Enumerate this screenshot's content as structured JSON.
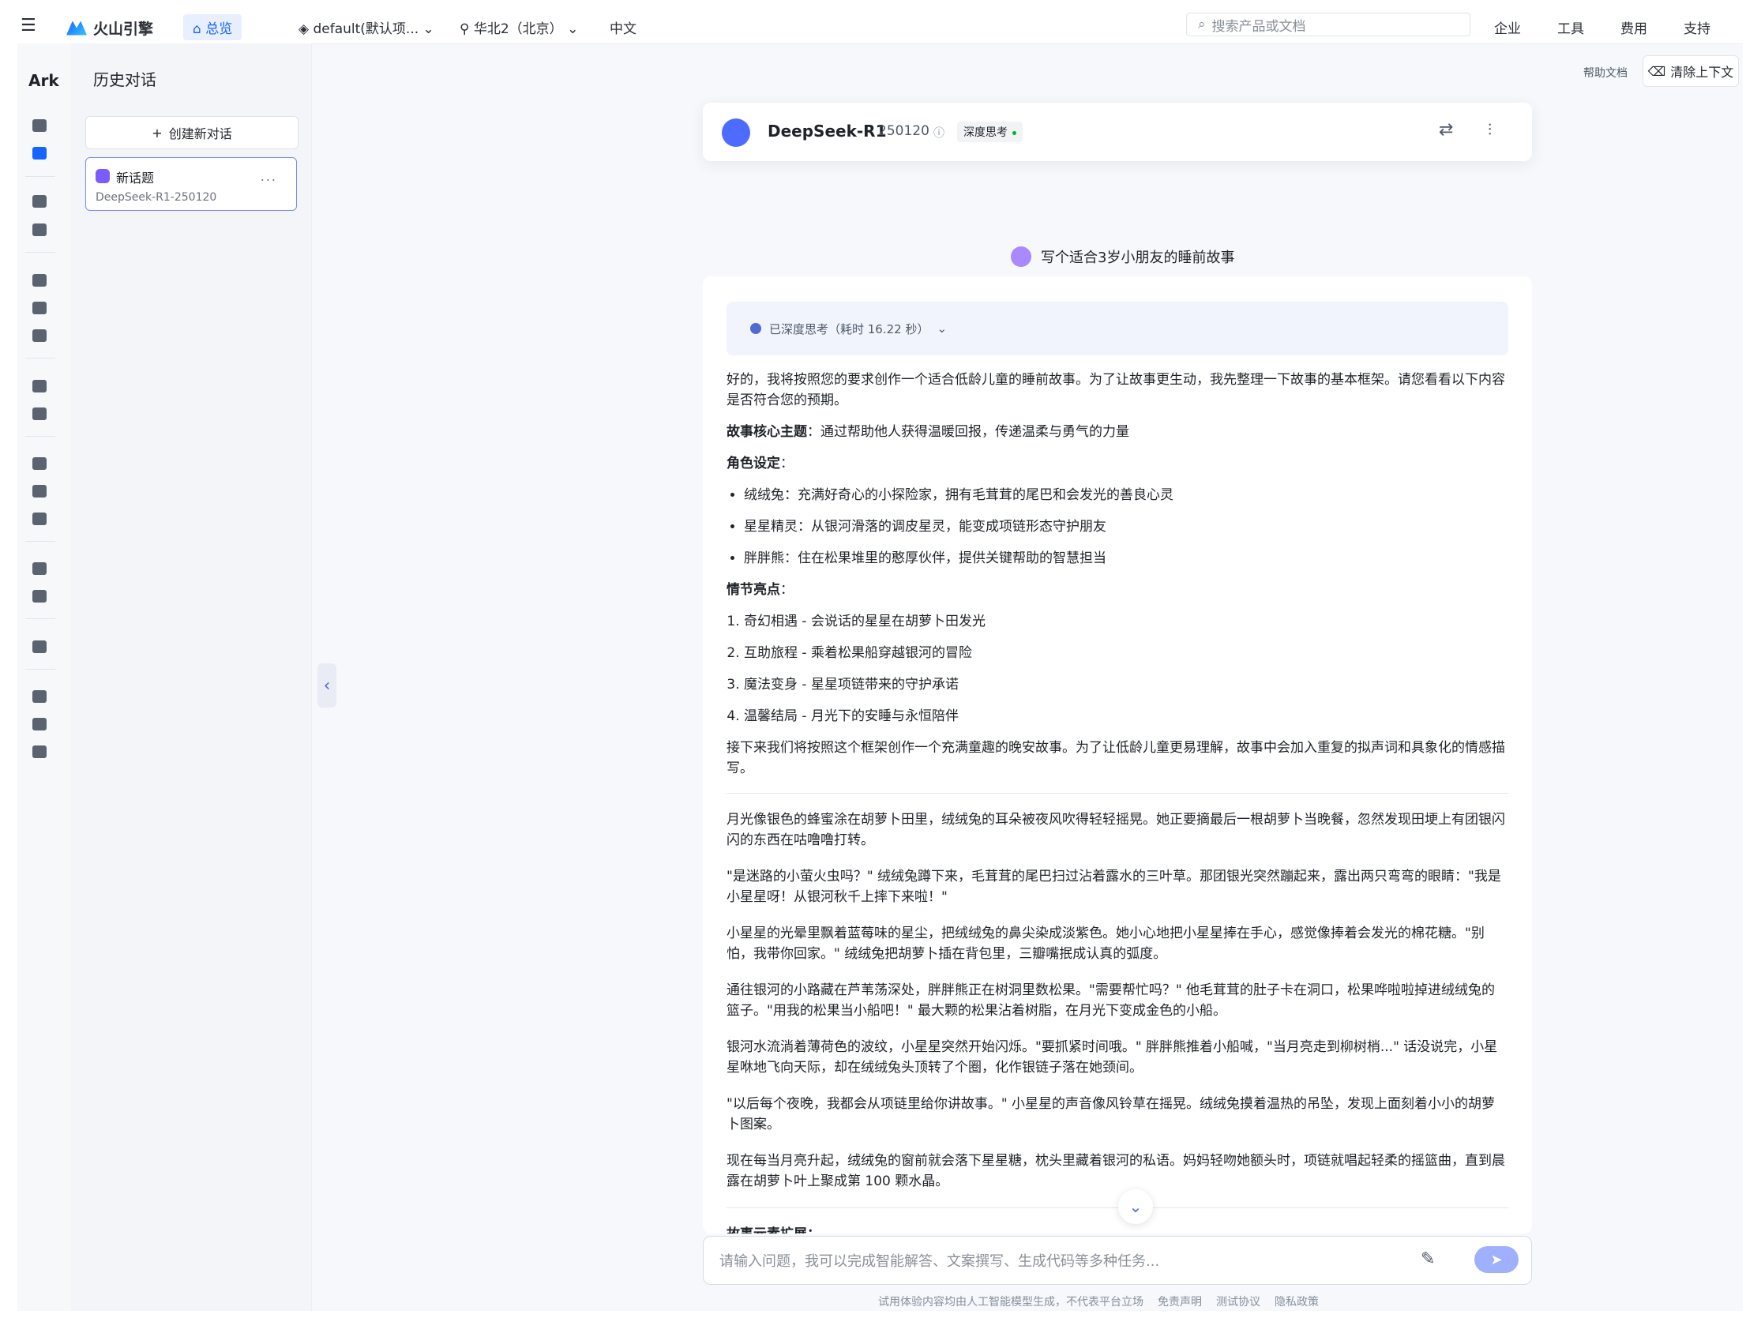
{
  "topbar": {
    "menu_icon": "menu-icon",
    "brand": "火山引擎",
    "home_label": "总览",
    "project_label": "default(默认项...",
    "region_label": "华北2（北京）",
    "language_label": "中文",
    "search_placeholder": "搜索产品或文档",
    "right_menus": [
      "企业",
      "工具",
      "费用",
      "支持"
    ]
  },
  "rail": {
    "brand": "Ark",
    "icons": [
      "bulb-icon",
      "chat-icon",
      "apps-icon",
      "storage-icon",
      "terminal-icon",
      "image-icon",
      "message-icon",
      "chart-icon",
      "rocket-icon",
      "tune-icon",
      "cube-icon",
      "flask-icon",
      "dashboard-icon",
      "server-icon",
      "headset-icon",
      "doc-icon",
      "shield-icon",
      "globe-icon"
    ]
  },
  "history": {
    "title": "历史对话",
    "new_chat_label": "创建新对话",
    "items": [
      {
        "title": "新话题",
        "subtitle": "DeepSeek-R1-250120",
        "more": "..."
      }
    ]
  },
  "header_actions": {
    "help_label": "帮助文档",
    "clear_label": "清除上下文"
  },
  "model": {
    "name": "DeepSeek-R1",
    "version": "250120",
    "badge": "深度思考"
  },
  "conversation": {
    "user_message": "写个适合3岁小朋友的睡前故事",
    "think_label": "已深度思考（耗时 16.22 秒）",
    "intro": "好的，我将按照您的要求创作一个适合低龄儿童的睡前故事。为了让故事更生动，我先整理一下故事的基本框架。请您看看以下内容是否符合您的预期。",
    "theme_label": "故事核心主题",
    "theme_text": "：通过帮助他人获得温暖回报，传递温柔与勇气的力量",
    "roles_label": "角色设定",
    "roles_colon": "：",
    "roles": [
      "绒绒兔：充满好奇心的小探险家，拥有毛茸茸的尾巴和会发光的善良心灵",
      "星星精灵：从银河滑落的调皮星灵，能变成项链形态守护朋友",
      "胖胖熊：住在松果堆里的憨厚伙伴，提供关键帮助的智慧担当"
    ],
    "plot_label": "情节亮点",
    "plot_colon": "：",
    "plot": [
      "奇幻相遇 - 会说话的星星在胡萝卜田发光",
      "互助旅程 - 乘着松果船穿越银河的冒险",
      "魔法变身 - 星星项链带来的守护承诺",
      "温馨结局 - 月光下的安睡与永恒陪伴"
    ],
    "transition": "接下来我们将按照这个框架创作一个充满童趣的晚安故事。为了让低龄儿童更易理解，故事中会加入重复的拟声词和具象化的情感描写。",
    "story": [
      "月光像银色的蜂蜜涂在胡萝卜田里，绒绒兔的耳朵被夜风吹得轻轻摇晃。她正要摘最后一根胡萝卜当晚餐，忽然发现田埂上有团银闪闪的东西在咕噜噜打转。",
      "\"是迷路的小萤火虫吗？\" 绒绒兔蹲下来，毛茸茸的尾巴扫过沾着露水的三叶草。那团银光突然蹦起来，露出两只弯弯的眼睛：\"我是小星星呀！从银河秋千上摔下来啦！\"",
      "小星星的光晕里飘着蓝莓味的星尘，把绒绒兔的鼻尖染成淡紫色。她小心地把小星星捧在手心，感觉像捧着会发光的棉花糖。\"别怕，我带你回家。\" 绒绒兔把胡萝卜插在背包里，三瓣嘴抿成认真的弧度。",
      "通往银河的小路藏在芦苇荡深处，胖胖熊正在树洞里数松果。\"需要帮忙吗？\" 他毛茸茸的肚子卡在洞口，松果哗啦啦掉进绒绒兔的篮子。\"用我的松果当小船吧！\" 最大颗的松果沾着树脂，在月光下变成金色的小船。",
      "银河水流淌着薄荷色的波纹，小星星突然开始闪烁。\"要抓紧时间哦。\" 胖胖熊推着小船喊，\"当月亮走到柳树梢...\" 话没说完，小星星咻地飞向天际，却在绒绒兔头顶转了个圈，化作银链子落在她颈间。",
      "\"以后每个夜晚，我都会从项链里给你讲故事。\" 小星星的声音像风铃草在摇晃。绒绒兔摸着温热的吊坠，发现上面刻着小小的胡萝卜图案。",
      "现在每当月亮升起，绒绒兔的窗前就会落下星星糖，枕头里藏着银河的私语。妈妈轻吻她额头时，项链就唱起轻柔的摇篮曲，直到晨露在胡萝卜叶上聚成第 100 颗水晶。"
    ],
    "clipped_heading": "故事元素扩展："
  },
  "composer": {
    "placeholder": "请输入问题，我可以完成智能解答、文案撰写、生成代码等多种任务..."
  },
  "footer": {
    "links": [
      "试用体验内容均由人工智能模型生成，不代表平台立场",
      "免责声明",
      "测试协议",
      "隐私政策"
    ]
  },
  "colors": {
    "accent": "#1664ff",
    "selection_border": "#7b8cff",
    "send_button": "#9fb0ff"
  }
}
